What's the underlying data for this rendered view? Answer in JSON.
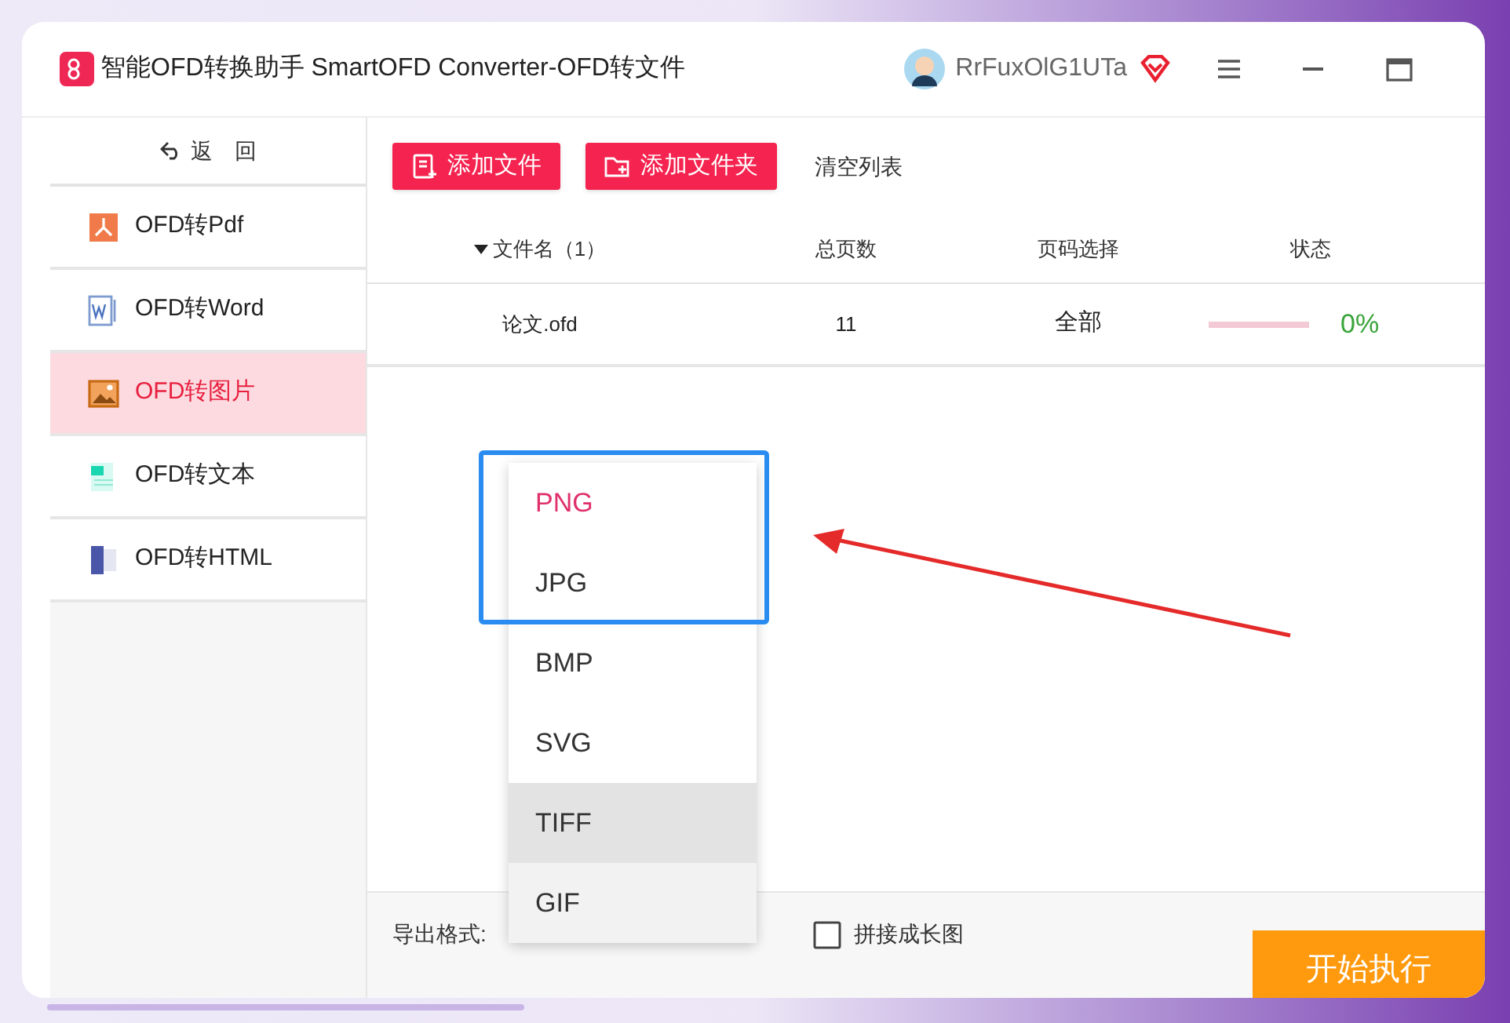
{
  "window": {
    "title": "智能OFD转换助手 SmartOFD Converter-OFD转文件",
    "user": "RrFuxOlG1UTa"
  },
  "sidebar": {
    "back": "返　回",
    "items": [
      {
        "label": "OFD转Pdf",
        "selected": false
      },
      {
        "label": "OFD转Word",
        "selected": false
      },
      {
        "label": "OFD转图片",
        "selected": true
      },
      {
        "label": "OFD转文本",
        "selected": false
      },
      {
        "label": "OFD转HTML",
        "selected": false
      }
    ]
  },
  "toolbar": {
    "buttons": [
      "添加文件",
      "添加文件夹"
    ],
    "clear": "清空列表"
  },
  "table": {
    "columns": [
      "文件名（1）",
      "总页数",
      "页码选择",
      "状态"
    ],
    "rows": [
      {
        "name": "论文.ofd",
        "pages": "11",
        "range": "全部",
        "level": 0,
        "progress": "0%"
      }
    ]
  },
  "format_menu": {
    "options": [
      {
        "label": "PNG",
        "selected": true,
        "hovered": false
      },
      {
        "label": "JPG",
        "selected": false,
        "hovered": false
      },
      {
        "label": "BMP",
        "selected": false,
        "hovered": false
      },
      {
        "label": "SVG",
        "selected": false,
        "hovered": false
      },
      {
        "label": "TIFF",
        "selected": false,
        "hovered": true
      },
      {
        "label": "GIF",
        "selected": false,
        "hovered": false
      }
    ]
  },
  "bottom": {
    "format_label": "导出格式:",
    "merge": {
      "label": "拼接成长图",
      "checked": false
    },
    "start": "开始执行"
  }
}
